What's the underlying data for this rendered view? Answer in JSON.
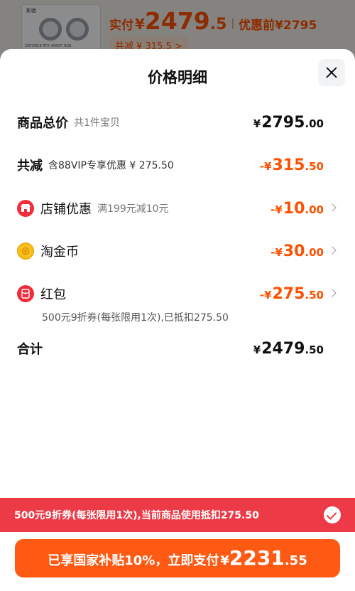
{
  "background": {
    "product_brand": "影驰",
    "product_model": "GEFORCE RTX 4060Ti 8GB",
    "price_prefix": "实付",
    "currency": "¥",
    "price_int": "2479",
    "price_dec": ".5",
    "separator": "|",
    "before_label": "优惠前",
    "before_price": "¥2795",
    "discount_tag": "共减 ¥ 315.5 >"
  },
  "sheet": {
    "title": "价格明细",
    "rows": {
      "total": {
        "label": "商品总价",
        "sub": "共1件宝贝",
        "yen": "¥",
        "int": "2795",
        "dec": ".00"
      },
      "reduce": {
        "label": "共减",
        "sub": "含88VIP专享优惠 ¥ 275.50",
        "yen": "-¥",
        "int": "315",
        "dec": ".50"
      },
      "shop": {
        "label": "店铺优惠",
        "sub": "满199元减10元",
        "yen": "-¥",
        "int": "10",
        "dec": ".00"
      },
      "coin": {
        "label": "淘金币",
        "yen": "-¥",
        "int": "30",
        "dec": ".00"
      },
      "redpack": {
        "label": "红包",
        "yen": "-¥",
        "int": "275",
        "dec": ".50",
        "note": "500元9折券(每张限用1次),已抵扣275.50"
      },
      "sum": {
        "label": "合计",
        "yen": "¥",
        "int": "2479",
        "dec": ".50"
      }
    }
  },
  "coupon_bar": {
    "text": "500元9折券(每张限用1次),当前商品使用抵扣275.50"
  },
  "pay_button": {
    "text": "已享国家补贴10%，立即支付",
    "yen": "¥",
    "int": "2231",
    "dec": ".55"
  },
  "colors": {
    "accent": "#ff5000",
    "red": "#ec3a47",
    "button": "#ff5a14"
  },
  "icons": [
    "close-icon",
    "shop-icon",
    "coin-icon",
    "red-packet-icon",
    "chevron-right-icon",
    "check-icon"
  ]
}
